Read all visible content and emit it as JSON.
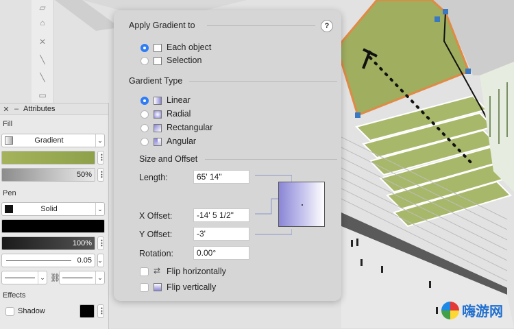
{
  "dialog": {
    "apply_header": "Apply Gradient to",
    "help_label": "?",
    "apply_options": [
      {
        "label": "Each object",
        "selected": true
      },
      {
        "label": "Selection",
        "selected": false
      }
    ],
    "type_header": "Gardient Type",
    "type_options": [
      {
        "label": "Linear",
        "selected": true
      },
      {
        "label": "Radial",
        "selected": false
      },
      {
        "label": "Rectangular",
        "selected": false
      },
      {
        "label": "Angular",
        "selected": false
      }
    ],
    "size_header": "Size and Offset",
    "length_label": "Length:",
    "length_value": "65' 14\"",
    "xoffset_label": "X Offset:",
    "xoffset_value": "-14' 5 1/2\"",
    "yoffset_label": "Y Offset:",
    "yoffset_value": "-3'",
    "rotation_label": "Rotation:",
    "rotation_value": "0.00°",
    "flip_h_label": "Flip horizontally",
    "flip_v_label": "Flip vertically",
    "gradient_colors": [
      "#8a86d6",
      "#ffffff"
    ]
  },
  "attributes": {
    "title": "Attributes",
    "fill_label": "Fill",
    "fill_type": "Gradient",
    "fill_gradient_colors": [
      "#a4b35c",
      "#8ea14a"
    ],
    "fill_opacity": "50%",
    "pen_label": "Pen",
    "pen_type": "Solid",
    "pen_color": "#000000",
    "pen_opacity": "100%",
    "line_weight": "0.05",
    "effects_label": "Effects",
    "shadow_label": "Shadow",
    "shadow_color": "#000000"
  },
  "watermark": {
    "text": "嗨游网"
  }
}
